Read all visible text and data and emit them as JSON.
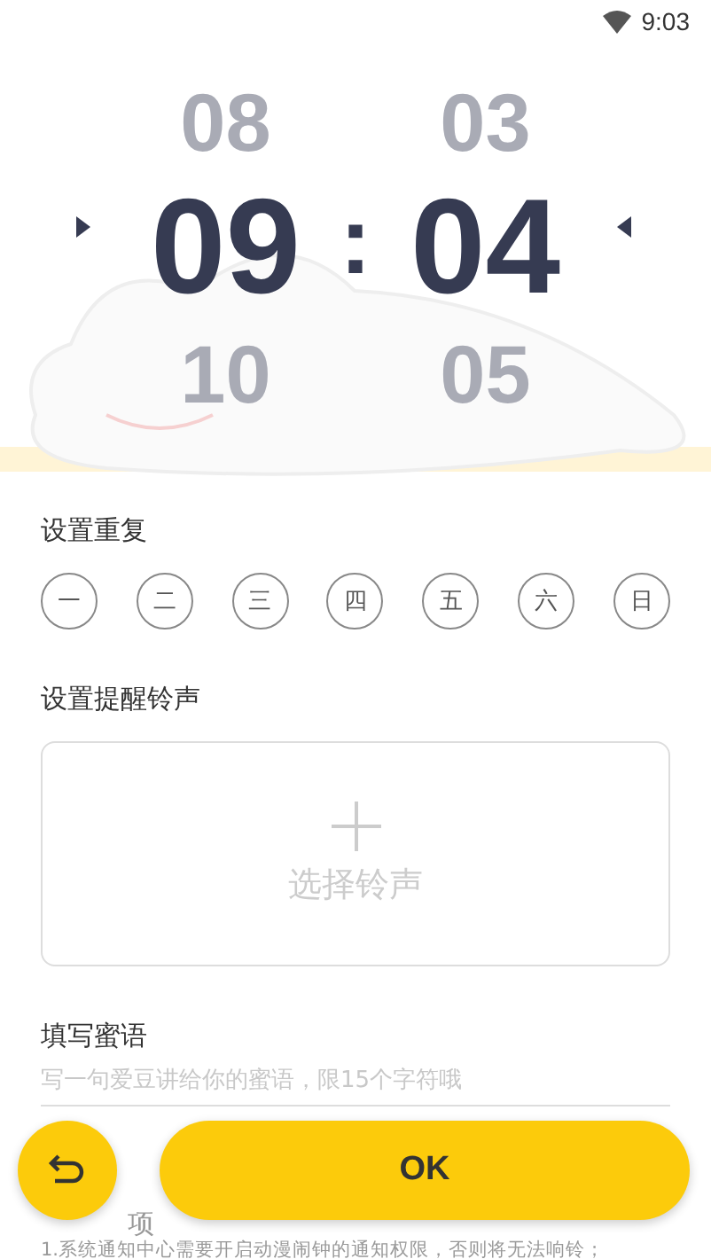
{
  "status_bar": {
    "time": "9:03"
  },
  "time_picker": {
    "columns": [
      {
        "items": [
          {
            "value": "08",
            "selected": false
          },
          {
            "value": "09",
            "selected": true
          },
          {
            "value": "10",
            "selected": false
          }
        ]
      },
      {
        "items": [
          {
            "value": "03",
            "selected": false
          },
          {
            "value": "04",
            "selected": true
          },
          {
            "value": "05",
            "selected": false
          }
        ]
      }
    ],
    "separator": ":"
  },
  "repeat": {
    "title": "设置重复",
    "days": [
      {
        "label": "一",
        "selected": false
      },
      {
        "label": "二",
        "selected": false
      },
      {
        "label": "三",
        "selected": false
      },
      {
        "label": "四",
        "selected": false
      },
      {
        "label": "五",
        "selected": false
      },
      {
        "label": "六",
        "selected": false
      },
      {
        "label": "日",
        "selected": false
      }
    ]
  },
  "ringtone": {
    "title": "设置提醒铃声",
    "button": "选择铃声"
  },
  "message": {
    "title": "填写蜜语",
    "placeholder": "写一句爱豆讲给你的蜜语，限15个字符哦"
  },
  "notes": {
    "title": "项",
    "lines": [
      "1.系统通知中心需要开启动漫闹钟的通知权限，否则将无法响铃；"
    ]
  },
  "ok_button": "OK"
}
